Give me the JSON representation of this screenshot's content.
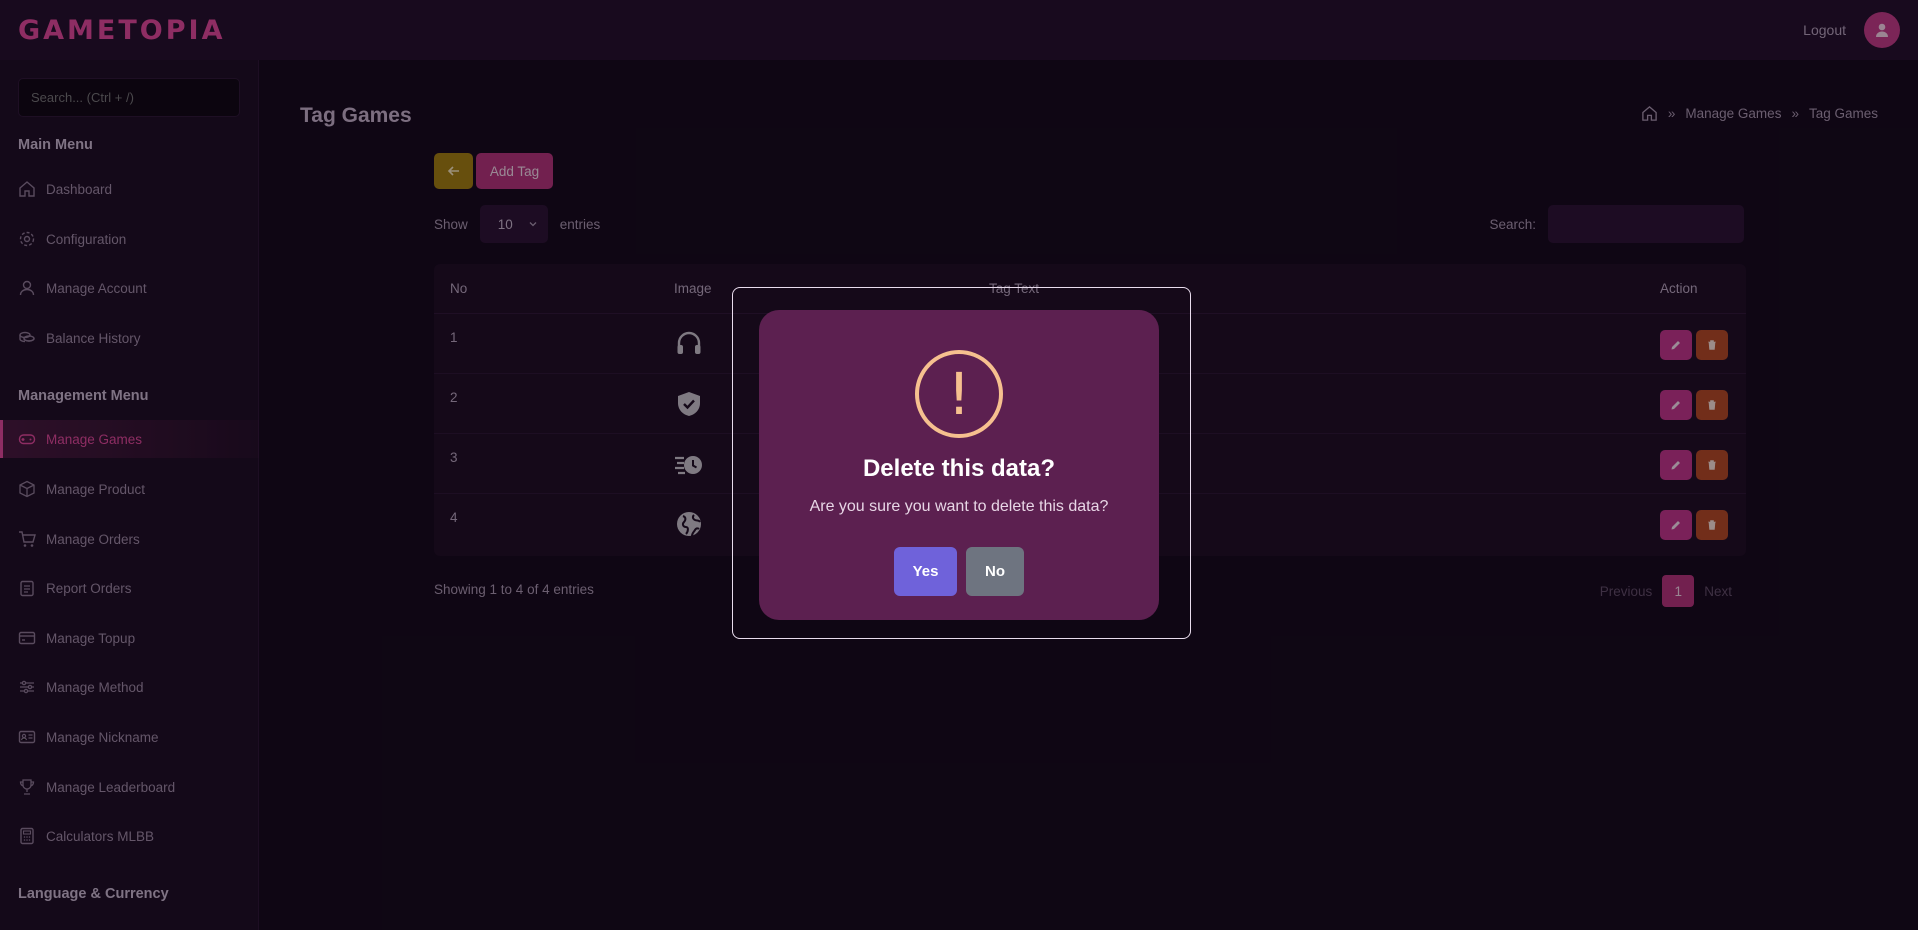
{
  "header": {
    "logo": "GAMETOPIA",
    "logout_label": "Logout"
  },
  "sidebar": {
    "search_placeholder": "Search... (Ctrl + /)",
    "main_menu_title": "Main Menu",
    "main_items": [
      {
        "label": "Dashboard",
        "icon": "home-icon"
      },
      {
        "label": "Configuration",
        "icon": "gear-icon"
      },
      {
        "label": "Manage Account",
        "icon": "user-icon"
      },
      {
        "label": "Balance History",
        "icon": "coins-icon"
      }
    ],
    "management_title": "Management Menu",
    "management_items": [
      {
        "label": "Manage Games",
        "icon": "gamepad-icon",
        "active": true
      },
      {
        "label": "Manage Product",
        "icon": "box-icon"
      },
      {
        "label": "Manage Orders",
        "icon": "cart-icon"
      },
      {
        "label": "Report Orders",
        "icon": "clipboard-icon"
      },
      {
        "label": "Manage Topup",
        "icon": "wallet-icon"
      },
      {
        "label": "Manage Method",
        "icon": "sliders-icon"
      },
      {
        "label": "Manage Nickname",
        "icon": "id-card-icon"
      },
      {
        "label": "Manage Leaderboard",
        "icon": "trophy-icon"
      },
      {
        "label": "Calculators MLBB",
        "icon": "calculator-icon"
      }
    ],
    "language_title": "Language & Currency"
  },
  "main": {
    "page_title": "Tag Games",
    "breadcrumb": [
      "Manage Games",
      "Tag Games"
    ],
    "add_tag_label": "Add Tag",
    "show_label": "Show",
    "entries_value": "10",
    "entries_label": "entries",
    "search_label": "Search:",
    "table": {
      "headers": [
        "No",
        "Image",
        "Tag Text",
        "Action"
      ],
      "rows": [
        {
          "no": "1",
          "icon": "headset-icon"
        },
        {
          "no": "2",
          "icon": "shield-check-icon"
        },
        {
          "no": "3",
          "icon": "fast-clock-icon"
        },
        {
          "no": "4",
          "icon": "globe-icon"
        }
      ]
    },
    "showing_text": "Showing 1 to 4 of 4 entries",
    "pager": {
      "previous": "Previous",
      "current": "1",
      "next": "Next"
    }
  },
  "modal": {
    "title": "Delete this data?",
    "text": "Are you sure you want to delete this data?",
    "yes_label": "Yes",
    "no_label": "No"
  },
  "colors": {
    "accent": "#e0489a",
    "warning": "#f6c08f",
    "confirm": "#6f62da",
    "cancel": "#6e7480"
  }
}
